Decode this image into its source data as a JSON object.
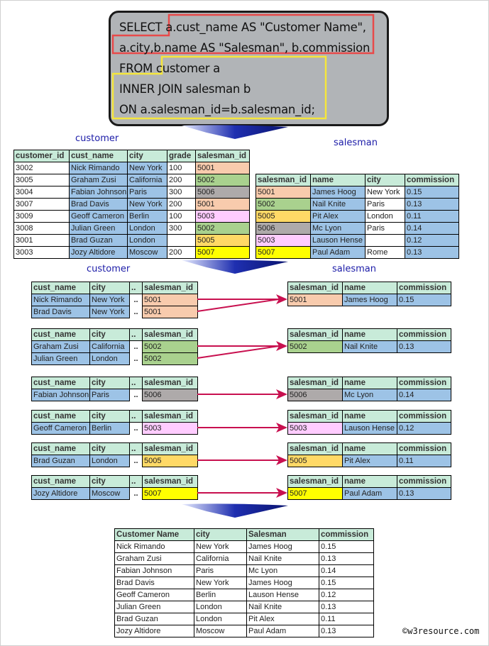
{
  "sql": {
    "lines": [
      "SELECT  a.cust_name AS \"Customer Name\",",
      "a.city,b.name AS \"Salesman\", b.commission",
      "FROM  customer a",
      "INNER JOIN salesman b",
      "ON a.salesman_id=b.salesman_id;"
    ],
    "select_highlight_color": "#e84a4a",
    "from_highlight_color": "#f5e63c"
  },
  "colors": {
    "header": "#c8ebd9",
    "blue": "#9dc3e6",
    "arrow": "#c8104f",
    "funnel": "#1f2fb0",
    "salesman_id": {
      "5001": "#f8cbad",
      "5002": "#a9d18e",
      "5006": "#aeaaaa",
      "5003": "#ffccff",
      "5005": "#ffd966",
      "5007": "#ffff00"
    }
  },
  "labels": {
    "customer_1": "customer",
    "salesman_1": "salesman",
    "customer_2": "customer",
    "salesman_2": "salesman"
  },
  "customer_table": {
    "headers": [
      "customer_id",
      "cust_name",
      "city",
      "grade",
      "salesman_id"
    ],
    "rows": [
      [
        "3002",
        "Nick Rimando",
        "New York",
        "100",
        "5001"
      ],
      [
        "3005",
        "Graham Zusi",
        "California",
        "200",
        "5002"
      ],
      [
        "3004",
        "Fabian Johnson",
        "Paris",
        "300",
        "5006"
      ],
      [
        "3007",
        "Brad Davis",
        "New York",
        "200",
        "5001"
      ],
      [
        "3009",
        "Geoff Cameron",
        "Berlin",
        "100",
        "5003"
      ],
      [
        "3008",
        "Julian Green",
        "London",
        "300",
        "5002"
      ],
      [
        "3001",
        "Brad Guzan",
        "London",
        "",
        "5005"
      ],
      [
        "3003",
        "Jozy Altidore",
        "Moscow",
        "200",
        "5007"
      ]
    ]
  },
  "salesman_table": {
    "headers": [
      "salesman_id",
      "name",
      "city",
      "commission"
    ],
    "rows": [
      [
        "5001",
        "James Hoog",
        "New York",
        "0.15"
      ],
      [
        "5002",
        "Nail Knite",
        "Paris",
        "0.13"
      ],
      [
        "5005",
        "Pit Alex",
        "London",
        "0.11"
      ],
      [
        "5006",
        "Mc Lyon",
        "Paris",
        "0.14"
      ],
      [
        "5003",
        "Lauson Hense",
        "",
        "0.12"
      ],
      [
        "5007",
        "Paul Adam",
        "Rome",
        "0.13"
      ]
    ]
  },
  "join_groups": {
    "left_headers": [
      "cust_name",
      "city",
      "..",
      "salesman_id"
    ],
    "right_headers": [
      "salesman_id",
      "name",
      "commission"
    ],
    "groups": [
      {
        "left": [
          [
            "Nick Rimando",
            "New York",
            "..",
            "5001"
          ],
          [
            "Brad Davis",
            "New York",
            "..",
            "5001"
          ]
        ],
        "right": [
          "5001",
          "James Hoog",
          "0.15"
        ]
      },
      {
        "left": [
          [
            "Graham Zusi",
            "California",
            "..",
            "5002"
          ],
          [
            "Julian Green",
            "London",
            "..",
            "5002"
          ]
        ],
        "right": [
          "5002",
          "Nail Knite",
          "0.13"
        ]
      },
      {
        "left": [
          [
            "Fabian Johnson",
            "Paris",
            "..",
            "5006"
          ]
        ],
        "right": [
          "5006",
          "Mc Lyon",
          "0.14"
        ]
      },
      {
        "left": [
          [
            "Geoff Cameron",
            "Berlin",
            "..",
            "5003"
          ]
        ],
        "right": [
          "5003",
          "Lauson Hense",
          "0.12"
        ]
      },
      {
        "left": [
          [
            "Brad Guzan",
            "London",
            "..",
            "5005"
          ]
        ],
        "right": [
          "5005",
          "Pit Alex",
          "0.11"
        ]
      },
      {
        "left": [
          [
            "Jozy Altidore",
            "Moscow",
            "..",
            "5007"
          ]
        ],
        "right": [
          "5007",
          "Paul Adam",
          "0.13"
        ]
      }
    ]
  },
  "result_table": {
    "headers": [
      "Customer Name",
      "city",
      "Salesman",
      "commission"
    ],
    "rows": [
      [
        "Nick Rimando",
        "New York",
        "James Hoog",
        "0.15"
      ],
      [
        "Graham Zusi",
        "California",
        "Nail Knite",
        "0.13"
      ],
      [
        "Fabian Johnson",
        "Paris",
        "Mc Lyon",
        "0.14"
      ],
      [
        "Brad Davis",
        "New York",
        "James Hoog",
        "0.15"
      ],
      [
        "Geoff Cameron",
        "Berlin",
        "Lauson Hense",
        "0.12"
      ],
      [
        "Julian Green",
        "London",
        "Nail Knite",
        "0.13"
      ],
      [
        "Brad Guzan",
        "London",
        "Pit Alex",
        "0.11"
      ],
      [
        "Jozy Altidore",
        "Moscow",
        "Paul Adam",
        "0.13"
      ]
    ]
  },
  "watermark": "©w3resource.com"
}
